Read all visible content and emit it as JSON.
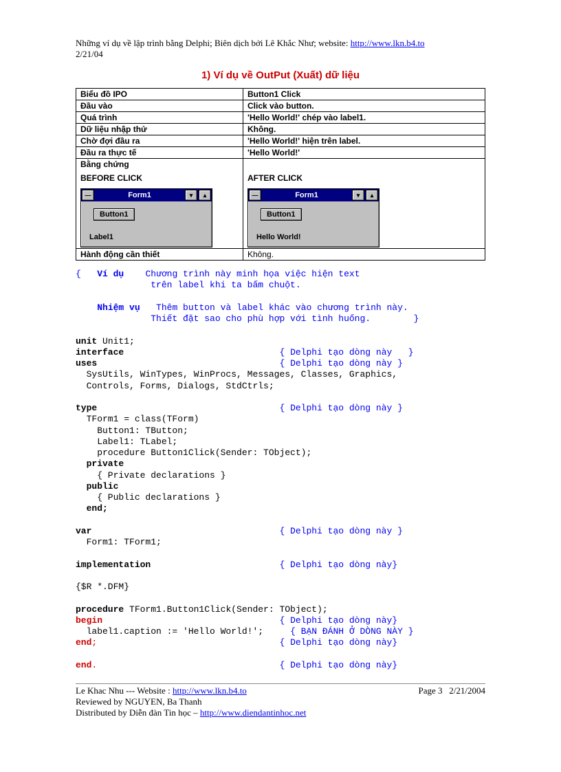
{
  "header": {
    "text_before": "Những ví dụ về lập trình bằng Delphi; Biên dịch bởi Lê Khắc Như; website: ",
    "link_text": "http://www.lkn.b4.to",
    "date": "2/21/04"
  },
  "title": "1) Ví dụ về OutPut (Xuất) dữ liệu",
  "ipo": [
    {
      "l": "Biểu đồ IPO",
      "r": "Button1 Click",
      "rb": true
    },
    {
      "l": "Đầu vào",
      "r": "Click vào button.",
      "rb": true
    },
    {
      "l": "Quá trình",
      "r": "'Hello World!' chép vào label1.",
      "rb": true
    },
    {
      "l": "Dữ liệu nhập thử",
      "r": "Không.",
      "rb": true
    },
    {
      "l": "Chờ đợi đầu ra",
      "r": "'Hello World!' hiện trên label.",
      "rb": true
    },
    {
      "l": "Đầu ra thực tế",
      "r": "'Hello World!'",
      "rb": true
    }
  ],
  "evidence": {
    "label": "Bằng chứng",
    "before_title": "BEFORE CLICK",
    "after_title": "AFTER CLICK",
    "form_title": "Form1",
    "button_label": "Button1",
    "before_label": "Label1",
    "after_label": "Hello World!"
  },
  "action_row": {
    "l": "Hành động cần thiết",
    "r": "Không."
  },
  "code": {
    "c1a": "{   ",
    "c1b": "Ví dụ",
    "c1c": "    Chương trình này minh họa việc hiện text",
    "c2": "              trên label khi ta bấm chuột.",
    "c3a": "    ",
    "c3b": "Nhiệm vụ",
    "c3c": "   Thêm button và label khác vào chương trình này.",
    "c4": "              Thiết đặt sao cho phù hợp với tình huống.        }",
    "unit": "unit",
    "unit_t": " Unit1;",
    "interface": "interface",
    "d_line": "{ Delphi tạo dòng này   }",
    "d_line2": "{ Delphi tạo dòng này }",
    "d_line3": "{ Delphi tạo dòng này}",
    "d_user": "{ BẠN ĐÁNH Ở DÒNG NÀY }",
    "uses": "uses",
    "uses_t1": "  SysUtils, WinTypes, WinProcs, Messages, Classes, Graphics,",
    "uses_t2": "  Controls, Forms, Dialogs, StdCtrls;",
    "type": "type",
    "type_t1": "  TForm1 = class(TForm)",
    "type_t2": "    Button1: TButton;",
    "type_t3": "    Label1: TLabel;",
    "type_t4": "    procedure Button1Click(Sender: TObject);",
    "private": "  private",
    "private_t": "    { Private declarations }",
    "public": "  public",
    "public_t": "    { Public declarations }",
    "end": "  end;",
    "var": "var",
    "var_t": "  Form1: TForm1;",
    "impl": "implementation",
    "dfm": "{$R *.DFM}",
    "proc": "procedure",
    "proc_t": " TForm1.Button1Click(Sender: TObject);",
    "begin": "begin",
    "body": "  label1.caption := 'Hello World!';",
    "endp": "end",
    "endpsemi": ";",
    "endf": "end",
    "endfdot": "."
  },
  "footer": {
    "l1a": "Le Khac Nhu  --- Website : ",
    "l1b": "http://www.lkn.b4.to",
    "page": "Page 3",
    "date": "2/21/2004",
    "l2": "Reviewed by NGUYEN, Ba Thanh",
    "l3a": "Distributed by Diễn đàn Tin học – ",
    "l3b": "http://www.diendantinhoc.net"
  }
}
